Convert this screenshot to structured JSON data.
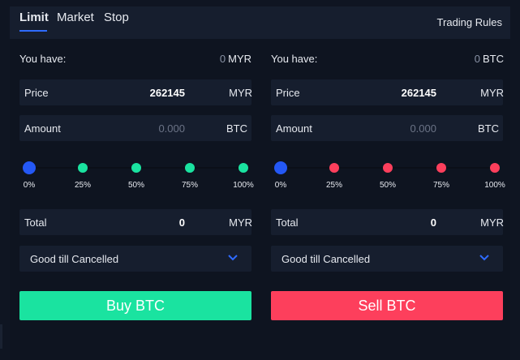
{
  "tabs": [
    {
      "label": "Limit",
      "active": true
    },
    {
      "label": "Market",
      "active": false
    },
    {
      "label": "Stop",
      "active": false
    }
  ],
  "trading_rules": "Trading Rules",
  "buy": {
    "you_have_label": "You have:",
    "balance_value": "0",
    "balance_unit": "MYR",
    "price_label": "Price",
    "price_value": "262145",
    "price_unit": "MYR",
    "amount_label": "Amount",
    "amount_placeholder": "0.000",
    "amount_unit": "BTC",
    "slider_value_percent": 0,
    "slider_ticks": [
      "0%",
      "25%",
      "50%",
      "75%",
      "100%"
    ],
    "total_label": "Total",
    "total_value": "0",
    "total_unit": "MYR",
    "order_type": "Good till Cancelled",
    "button_label": "Buy BTC"
  },
  "sell": {
    "you_have_label": "You have:",
    "balance_value": "0",
    "balance_unit": "BTC",
    "price_label": "Price",
    "price_value": "262145",
    "price_unit": "MYR",
    "amount_label": "Amount",
    "amount_placeholder": "0.000",
    "amount_unit": "BTC",
    "slider_value_percent": 0,
    "slider_ticks": [
      "0%",
      "25%",
      "50%",
      "75%",
      "100%"
    ],
    "total_label": "Total",
    "total_value": "0",
    "total_unit": "MYR",
    "order_type": "Good till Cancelled",
    "button_label": "Sell BTC"
  },
  "colors": {
    "accent_blue": "#2458f5",
    "buy_green": "#1ae3a0",
    "sell_red": "#fd3f5c",
    "panel_bg": "#161e2e"
  }
}
